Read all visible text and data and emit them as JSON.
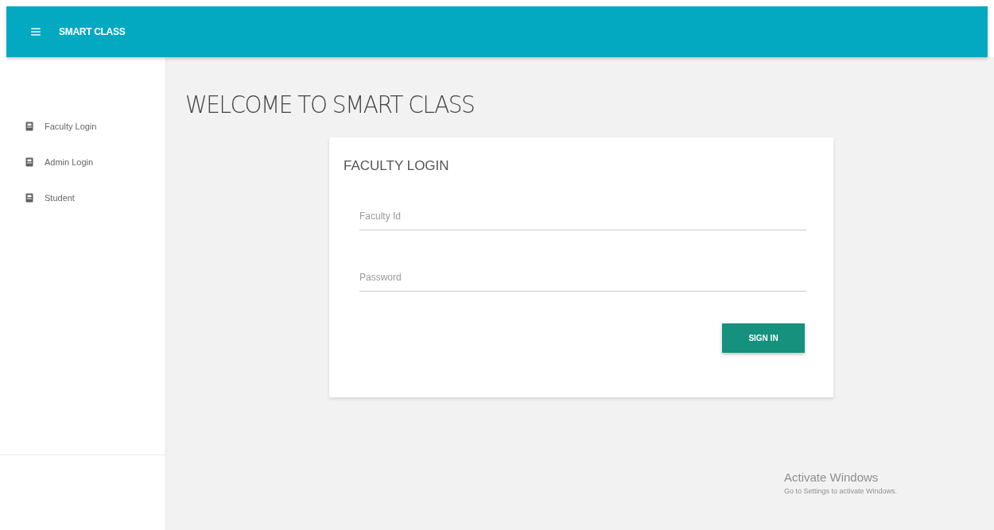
{
  "app_bar": {
    "title": "SMART CLASS"
  },
  "sidebar": {
    "items": [
      {
        "label": "Faculty Login"
      },
      {
        "label": "Admin Login"
      },
      {
        "label": "Student"
      }
    ]
  },
  "main": {
    "heading": "WELCOME TO SMART CLASS"
  },
  "login_card": {
    "title": "FACULTY LOGIN",
    "fields": [
      {
        "placeholder": "Faculty Id"
      },
      {
        "placeholder": "Password"
      }
    ],
    "button": "SIGN IN"
  },
  "os_notice": {
    "title": "Activate Windows",
    "text": "Go to Settings to activate Windows."
  }
}
